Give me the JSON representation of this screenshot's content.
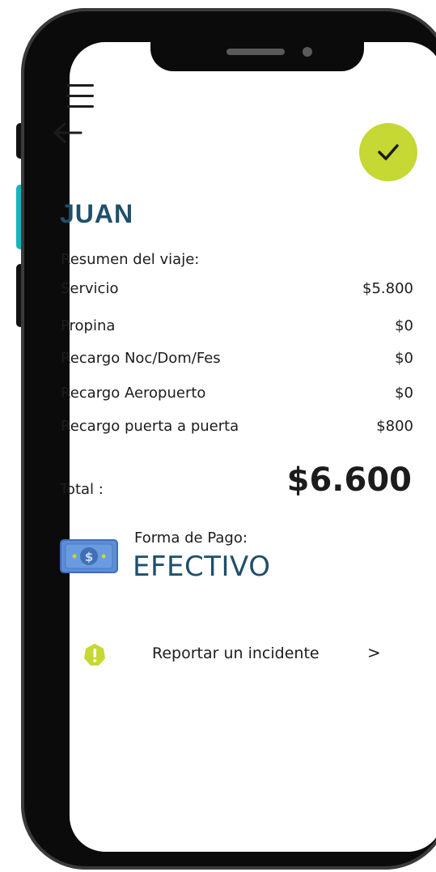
{
  "header": {
    "menu_icon": "hamburger-menu-icon",
    "back_icon": "arrow-left-icon",
    "confirm_icon": "check-icon",
    "confirm_color": "#c5d833"
  },
  "passenger": {
    "name": "JUAN"
  },
  "summary": {
    "title": "Resumen del viaje:",
    "items": [
      {
        "label": "Servicio",
        "value": "$5.800"
      },
      {
        "label": "Propina",
        "value": "$0"
      },
      {
        "label": "Recargo Noc/Dom/Fes",
        "value": "$0"
      },
      {
        "label": "Recargo Aeropuerto",
        "value": "$0"
      },
      {
        "label": "Recargo puerta a puerta",
        "value": "$800"
      }
    ],
    "total_label": "Total :",
    "total_value": "$6.600"
  },
  "payment": {
    "icon": "cash-bill-icon",
    "label": "Forma de Pago:",
    "method": "EFECTIVO"
  },
  "incident": {
    "icon": "alert-icon",
    "label": "Reportar un incidente",
    "chevron": ">"
  },
  "colors": {
    "accent": "#c5d833",
    "heading": "#1f4f6b",
    "side_button_accent": "#16b4c0"
  }
}
